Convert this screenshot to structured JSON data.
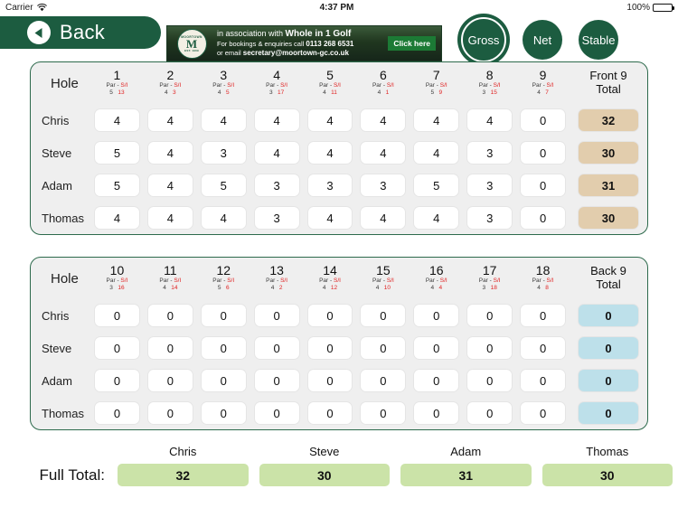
{
  "status_bar": {
    "carrier": "Carrier",
    "wifi_icon": "wifi-icon",
    "time": "4:37 PM",
    "battery_percent": "100%",
    "battery_icon": "battery-icon"
  },
  "topbar": {
    "back_label": "Back",
    "back_icon": "back-arrow-icon"
  },
  "banner": {
    "logo_alt": "moortown-crest-icon",
    "crest_top": "MOORTOWN",
    "crest_initial": "M",
    "crest_bottom": "EST. 1909",
    "line1_pre": "in association with ",
    "line1_strong": "Whole in 1 Golf",
    "line2_pre": "For bookings & enquiries call ",
    "line2_strong": "0113 268 6531",
    "line3_pre": "or email ",
    "line3_strong": "secretary@moortown-gc.co.uk",
    "cta": "Click here"
  },
  "mode_tabs": [
    {
      "label": "Gross",
      "selected": true
    },
    {
      "label": "Net",
      "selected": false
    },
    {
      "label": "Stable",
      "selected": false
    }
  ],
  "labels": {
    "hole": "Hole",
    "par": "Par",
    "dash": "-",
    "si": "S/I",
    "front_total": "Front 9\nTotal",
    "front_total_l1": "Front 9",
    "front_total_l2": "Total",
    "back_total_l1": "Back 9",
    "back_total_l2": "Total",
    "full_total": "Full Total:"
  },
  "players": [
    "Chris",
    "Steve",
    "Adam",
    "Thomas"
  ],
  "front_nine": {
    "holes": [
      {
        "number": "1",
        "par": "5",
        "si": "13"
      },
      {
        "number": "2",
        "par": "4",
        "si": "3"
      },
      {
        "number": "3",
        "par": "4",
        "si": "5"
      },
      {
        "number": "4",
        "par": "3",
        "si": "17"
      },
      {
        "number": "5",
        "par": "4",
        "si": "11"
      },
      {
        "number": "6",
        "par": "4",
        "si": "1"
      },
      {
        "number": "7",
        "par": "5",
        "si": "9"
      },
      {
        "number": "8",
        "par": "3",
        "si": "15"
      },
      {
        "number": "9",
        "par": "4",
        "si": "7"
      }
    ],
    "scores": [
      {
        "player": "Chris",
        "values": [
          "4",
          "4",
          "4",
          "4",
          "4",
          "4",
          "4",
          "4",
          "0"
        ],
        "total": "32"
      },
      {
        "player": "Steve",
        "values": [
          "5",
          "4",
          "3",
          "4",
          "4",
          "4",
          "4",
          "3",
          "0"
        ],
        "total": "30"
      },
      {
        "player": "Adam",
        "values": [
          "5",
          "4",
          "5",
          "3",
          "3",
          "3",
          "5",
          "3",
          "0"
        ],
        "total": "31"
      },
      {
        "player": "Thomas",
        "values": [
          "4",
          "4",
          "4",
          "3",
          "4",
          "4",
          "4",
          "3",
          "0"
        ],
        "total": "30"
      }
    ]
  },
  "back_nine": {
    "holes": [
      {
        "number": "10",
        "par": "3",
        "si": "16"
      },
      {
        "number": "11",
        "par": "4",
        "si": "14"
      },
      {
        "number": "12",
        "par": "5",
        "si": "6"
      },
      {
        "number": "13",
        "par": "4",
        "si": "2"
      },
      {
        "number": "14",
        "par": "4",
        "si": "12"
      },
      {
        "number": "15",
        "par": "4",
        "si": "10"
      },
      {
        "number": "16",
        "par": "4",
        "si": "4"
      },
      {
        "number": "17",
        "par": "3",
        "si": "18"
      },
      {
        "number": "18",
        "par": "4",
        "si": "8"
      }
    ],
    "scores": [
      {
        "player": "Chris",
        "values": [
          "0",
          "0",
          "0",
          "0",
          "0",
          "0",
          "0",
          "0",
          "0"
        ],
        "total": "0"
      },
      {
        "player": "Steve",
        "values": [
          "0",
          "0",
          "0",
          "0",
          "0",
          "0",
          "0",
          "0",
          "0"
        ],
        "total": "0"
      },
      {
        "player": "Adam",
        "values": [
          "0",
          "0",
          "0",
          "0",
          "0",
          "0",
          "0",
          "0",
          "0"
        ],
        "total": "0"
      },
      {
        "player": "Thomas",
        "values": [
          "0",
          "0",
          "0",
          "0",
          "0",
          "0",
          "0",
          "0",
          "0"
        ],
        "total": "0"
      }
    ]
  },
  "full_totals": [
    {
      "player": "Chris",
      "value": "32"
    },
    {
      "player": "Steve",
      "value": "30"
    },
    {
      "player": "Adam",
      "value": "31"
    },
    {
      "player": "Thomas",
      "value": "30"
    }
  ],
  "colors": {
    "brand_green": "#1c5c40",
    "card_border": "#2d6a4c",
    "card_fill": "#efefef",
    "front_total_bg": "#e2cdad",
    "back_total_bg": "#bde0ea",
    "full_total_bg": "#cbe3a8",
    "si_red": "#e02222",
    "cta_green": "#1c7a35"
  }
}
